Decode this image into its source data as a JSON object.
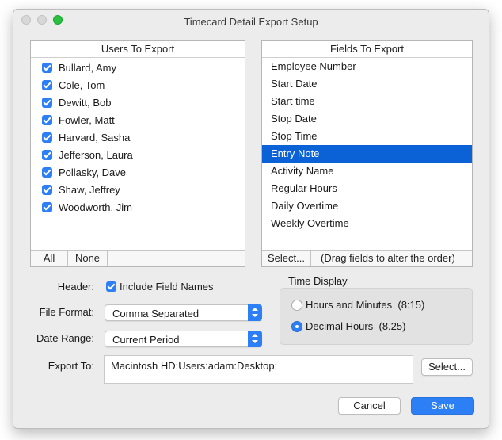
{
  "window": {
    "title": "Timecard Detail Export Setup"
  },
  "users_panel": {
    "header": "Users To Export",
    "items": [
      {
        "label": "Bullard, Amy",
        "checked": true
      },
      {
        "label": "Cole, Tom",
        "checked": true
      },
      {
        "label": "Dewitt, Bob",
        "checked": true
      },
      {
        "label": "Fowler, Matt",
        "checked": true
      },
      {
        "label": "Harvard, Sasha",
        "checked": true
      },
      {
        "label": "Jefferson, Laura",
        "checked": true
      },
      {
        "label": "Pollasky, Dave",
        "checked": true
      },
      {
        "label": "Shaw, Jeffrey",
        "checked": true
      },
      {
        "label": "Woodworth, Jim",
        "checked": true
      }
    ],
    "all_label": "All",
    "none_label": "None"
  },
  "fields_panel": {
    "header": "Fields To Export",
    "items": [
      {
        "label": "Employee Number"
      },
      {
        "label": "Start Date"
      },
      {
        "label": "Start time"
      },
      {
        "label": "Stop Date"
      },
      {
        "label": "Stop Time"
      },
      {
        "label": "Entry Note",
        "selected": true
      },
      {
        "label": "Activity Name"
      },
      {
        "label": "Regular Hours"
      },
      {
        "label": "Daily Overtime"
      },
      {
        "label": "Weekly Overtime"
      }
    ],
    "select_label": "Select...",
    "hint": "(Drag fields to alter the order)"
  },
  "form": {
    "header_label": "Header:",
    "include_field_names_label": "Include Field Names",
    "include_field_names_checked": true,
    "file_format_label": "File Format:",
    "file_format_value": "Comma Separated",
    "date_range_label": "Date Range:",
    "date_range_value": "Current Period",
    "export_to_label": "Export To:",
    "export_to_value": "Macintosh HD:Users:adam:Desktop:",
    "export_select_label": "Select..."
  },
  "time_display": {
    "title": "Time Display",
    "options": [
      {
        "label": "Hours and Minutes",
        "example": "(8:15)",
        "selected": false
      },
      {
        "label": "Decimal Hours",
        "example": "(8.25)",
        "selected": true
      }
    ]
  },
  "buttons": {
    "cancel": "Cancel",
    "save": "Save"
  },
  "colors": {
    "accent": "#2d7ff6",
    "selection": "#0a62d6"
  }
}
